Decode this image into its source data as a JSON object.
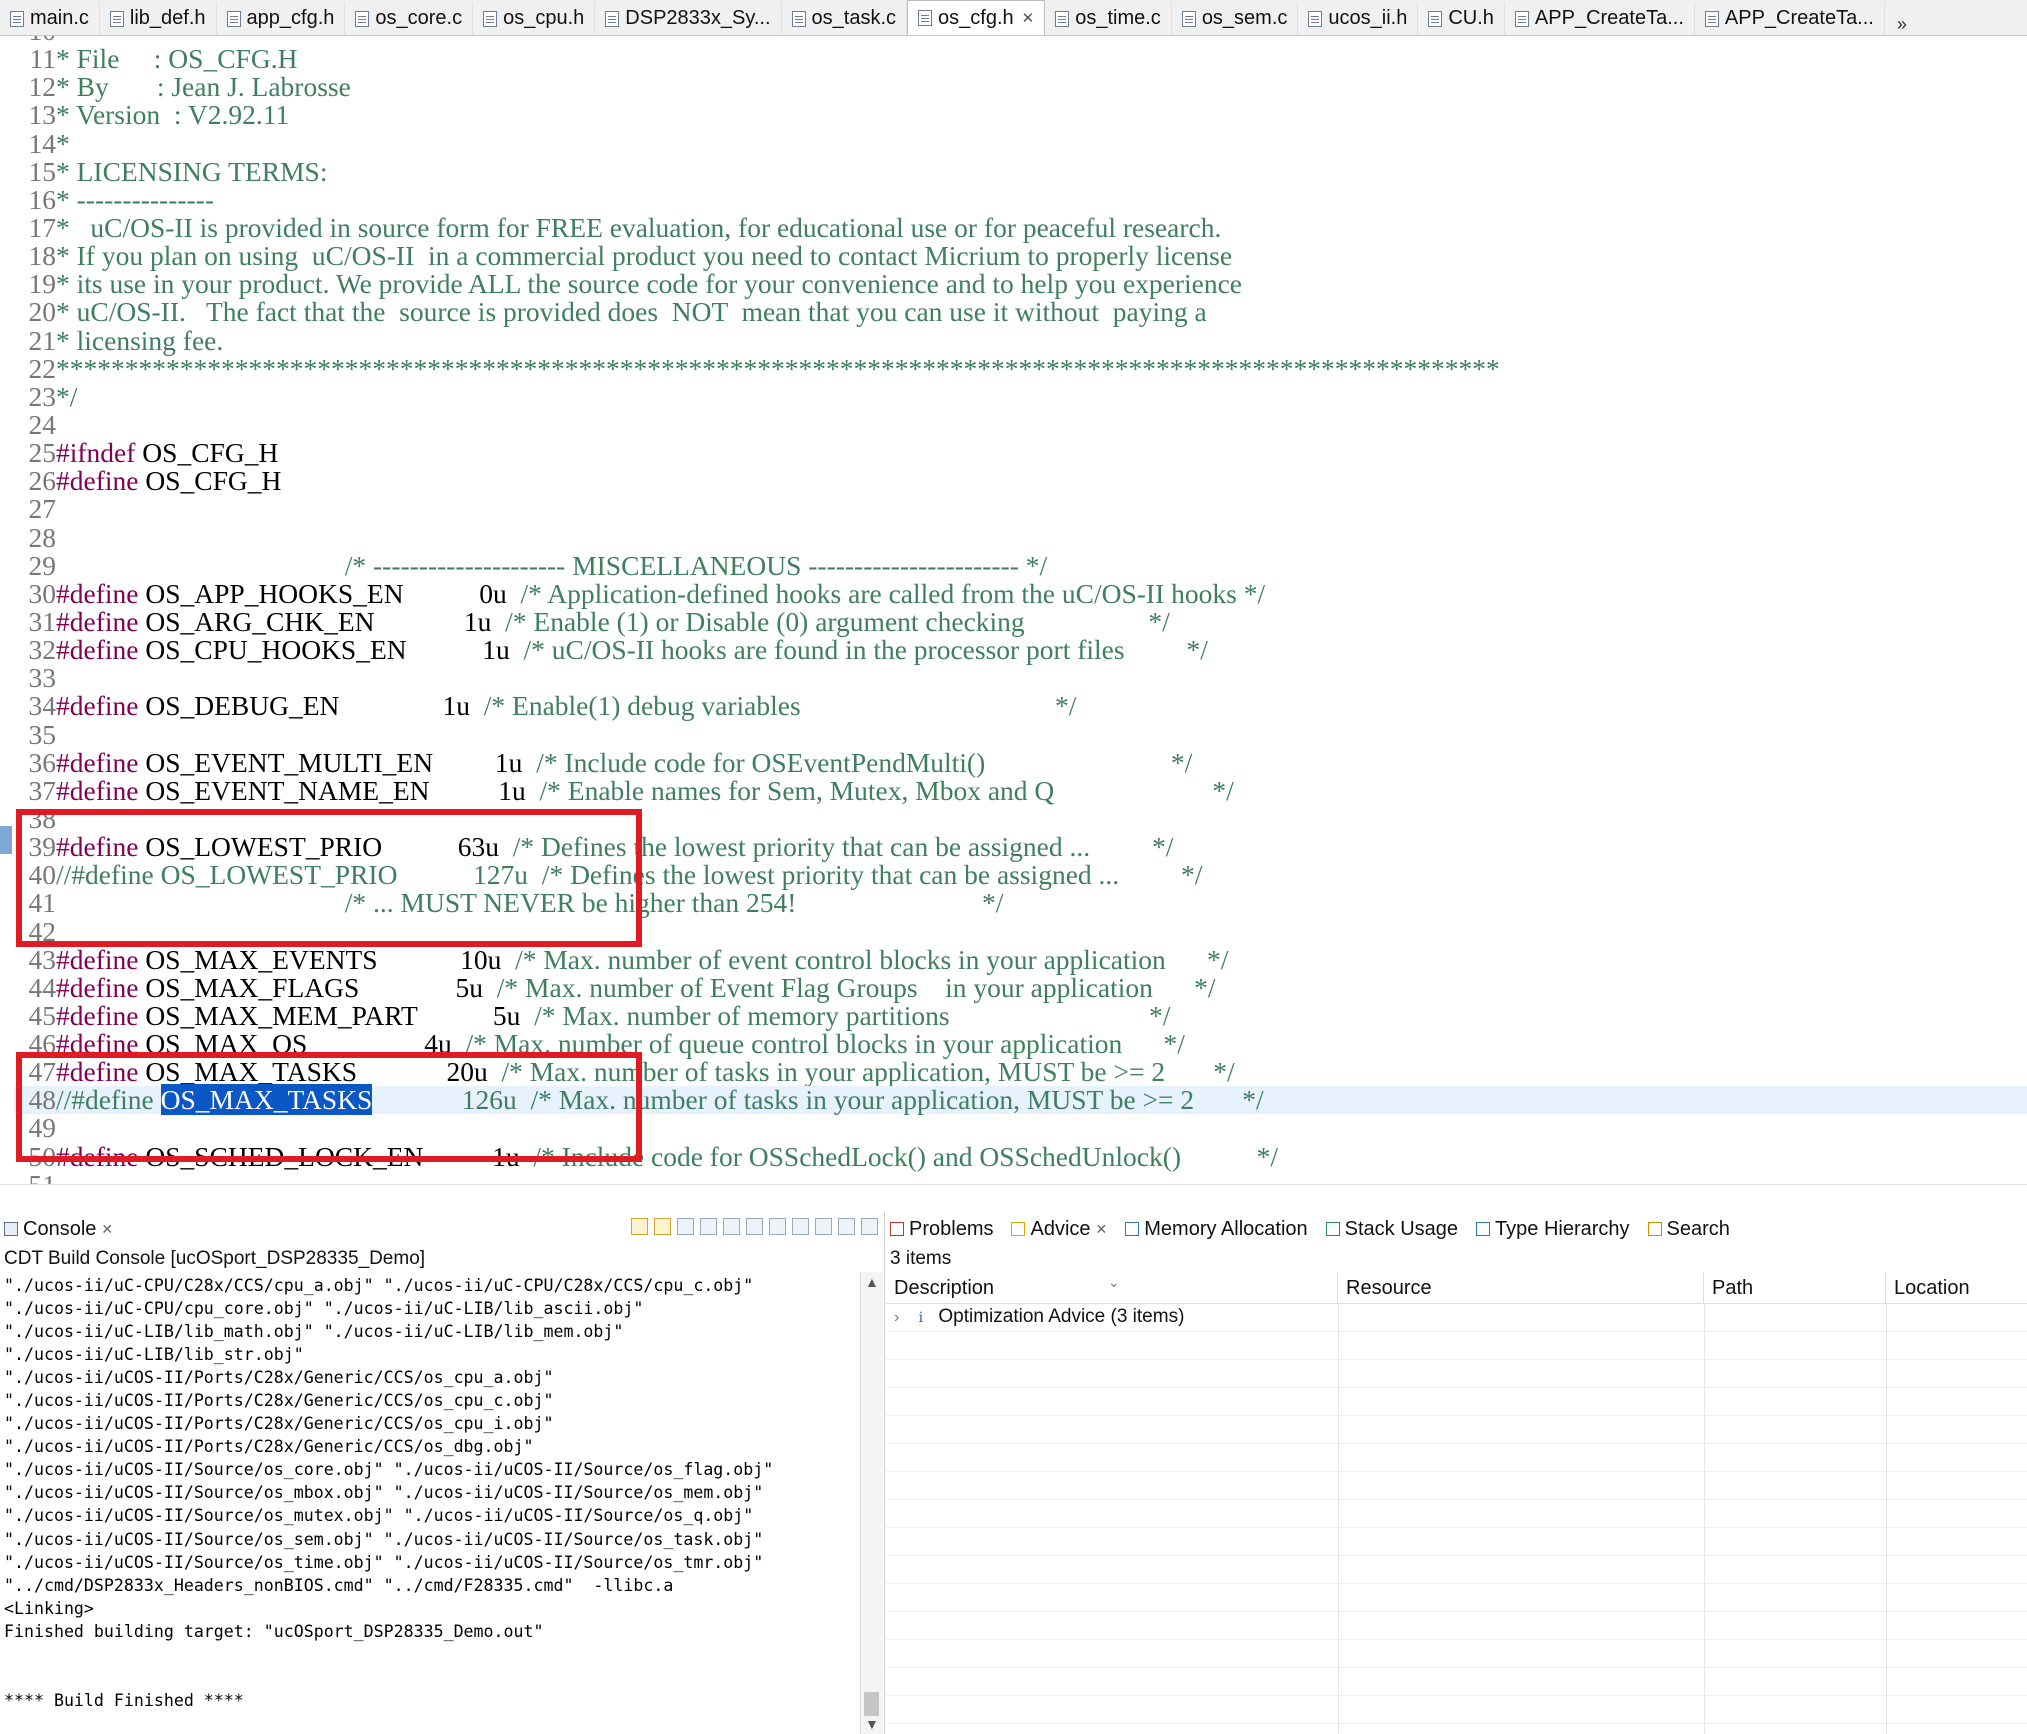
{
  "editor_tabs": [
    "main.c",
    "lib_def.h",
    "app_cfg.h",
    "os_core.c",
    "os_cpu.h",
    "DSP2833x_Sy...",
    "os_task.c",
    "os_cfg.h",
    "os_time.c",
    "os_sem.c",
    "ucos_ii.h",
    "CU.h",
    "APP_CreateTa...",
    "APP_CreateTa..."
  ],
  "active_tab": "os_cfg.h",
  "tab_overflow": "»",
  "code_lines": [
    {
      "n": "10",
      "t": "*"
    },
    {
      "n": "11",
      "t": "* File     : OS_CFG.H"
    },
    {
      "n": "12",
      "t": "* By       : Jean J. Labrosse"
    },
    {
      "n": "13",
      "t": "* Version  : V2.92.11"
    },
    {
      "n": "14",
      "t": "*"
    },
    {
      "n": "15",
      "t": "* LICENSING TERMS:"
    },
    {
      "n": "16",
      "t": "* ---------------"
    },
    {
      "n": "17",
      "t": "*   uC/OS-II is provided in source form for FREE evaluation, for educational use or for peaceful research."
    },
    {
      "n": "18",
      "t": "* If you plan on using  uC/OS-II  in a commercial product you need to contact Micrium to properly license"
    },
    {
      "n": "19",
      "t": "* its use in your product. We provide ALL the source code for your convenience and to help you experience"
    },
    {
      "n": "20",
      "t": "* uC/OS-II.   The fact that the  source is provided does  NOT  mean that you can use it without  paying a"
    },
    {
      "n": "21",
      "t": "* licensing fee."
    },
    {
      "n": "22",
      "t": "*********************************************************************************************************"
    },
    {
      "n": "23",
      "t": "*/"
    },
    {
      "n": "24",
      "t": ""
    },
    {
      "n": "25",
      "kw": "#ifndef",
      "t": " OS_CFG_H"
    },
    {
      "n": "26",
      "kw": "#define",
      "t": " OS_CFG_H"
    },
    {
      "n": "27",
      "t": ""
    },
    {
      "n": "28",
      "t": ""
    },
    {
      "n": "29",
      "c": "                                          /* --------------------- MISCELLANEOUS ----------------------- */"
    },
    {
      "n": "30",
      "kw": "#define",
      "t": " OS_APP_HOOKS_EN           0u",
      "c": "  /* Application-defined hooks are called from the uC/OS-II hooks */"
    },
    {
      "n": "31",
      "kw": "#define",
      "t": " OS_ARG_CHK_EN             1u",
      "c": "  /* Enable (1) or Disable (0) argument checking                  */"
    },
    {
      "n": "32",
      "kw": "#define",
      "t": " OS_CPU_HOOKS_EN           1u",
      "c": "  /* uC/OS-II hooks are found in the processor port files         */"
    },
    {
      "n": "33",
      "t": ""
    },
    {
      "n": "34",
      "kw": "#define",
      "t": " OS_DEBUG_EN               1u",
      "c": "  /* Enable(1) debug variables                                     */"
    },
    {
      "n": "35",
      "t": ""
    },
    {
      "n": "36",
      "kw": "#define",
      "t": " OS_EVENT_MULTI_EN         1u",
      "c": "  /* Include code for OSEventPendMulti()                           */"
    },
    {
      "n": "37",
      "kw": "#define",
      "t": " OS_EVENT_NAME_EN          1u",
      "c": "  /* Enable names for Sem, Mutex, Mbox and Q                       */"
    },
    {
      "n": "38",
      "t": ""
    },
    {
      "n": "39",
      "kw": "#define",
      "t": " OS_LOWEST_PRIO           63u",
      "c": "  /* Defines the lowest priority that can be assigned ...         */"
    },
    {
      "n": "40",
      "c": "//#define OS_LOWEST_PRIO           127u  /* Defines the lowest priority that can be assigned ...         */"
    },
    {
      "n": "41",
      "c": "                                          /* ... MUST NEVER be higher than 254!                           */"
    },
    {
      "n": "42",
      "t": ""
    },
    {
      "n": "43",
      "kw": "#define",
      "t": " OS_MAX_EVENTS            10u",
      "c": "  /* Max. number of event control blocks in your application      */"
    },
    {
      "n": "44",
      "kw": "#define",
      "t": " OS_MAX_FLAGS              5u",
      "c": "  /* Max. number of Event Flag Groups    in your application      */"
    },
    {
      "n": "45",
      "kw": "#define",
      "t": " OS_MAX_MEM_PART           5u",
      "c": "  /* Max. number of memory partitions                             */"
    },
    {
      "n": "46",
      "kw": "#define",
      "t": " OS_MAX_QS                 4u",
      "c": "  /* Max. number of queue control blocks in your application      */"
    },
    {
      "n": "47",
      "kw": "#define",
      "t": " OS_MAX_TASKS             20u",
      "c": "  /* Max. number of tasks in your application, MUST be >= 2       */"
    },
    {
      "n": "48",
      "c": "//#define ",
      "sel": "OS_MAX_TASKS",
      "c2": "             126u  /* Max. number of tasks in your application, MUST be >= 2       */"
    },
    {
      "n": "49",
      "t": ""
    },
    {
      "n": "50",
      "kw": "#define",
      "t": " OS_SCHED_LOCK_EN          1u",
      "c": "  /* Include code for OSSchedLock() and OSSchedUnlock()           */"
    },
    {
      "n": "51",
      "t": ""
    }
  ],
  "console": {
    "tab_label": "Console",
    "title": "CDT Build Console [ucOSport_DSP28335_Demo]",
    "lines": [
      "\"./ucos-ii/uC-CPU/C28x/CCS/cpu_a.obj\" \"./ucos-ii/uC-CPU/C28x/CCS/cpu_c.obj\"",
      "\"./ucos-ii/uC-CPU/cpu_core.obj\" \"./ucos-ii/uC-LIB/lib_ascii.obj\"",
      "\"./ucos-ii/uC-LIB/lib_math.obj\" \"./ucos-ii/uC-LIB/lib_mem.obj\"",
      "\"./ucos-ii/uC-LIB/lib_str.obj\"",
      "\"./ucos-ii/uCOS-II/Ports/C28x/Generic/CCS/os_cpu_a.obj\"",
      "\"./ucos-ii/uCOS-II/Ports/C28x/Generic/CCS/os_cpu_c.obj\"",
      "\"./ucos-ii/uCOS-II/Ports/C28x/Generic/CCS/os_cpu_i.obj\"",
      "\"./ucos-ii/uCOS-II/Ports/C28x/Generic/CCS/os_dbg.obj\"",
      "\"./ucos-ii/uCOS-II/Source/os_core.obj\" \"./ucos-ii/uCOS-II/Source/os_flag.obj\"",
      "\"./ucos-ii/uCOS-II/Source/os_mbox.obj\" \"./ucos-ii/uCOS-II/Source/os_mem.obj\"",
      "\"./ucos-ii/uCOS-II/Source/os_mutex.obj\" \"./ucos-ii/uCOS-II/Source/os_q.obj\"",
      "\"./ucos-ii/uCOS-II/Source/os_sem.obj\" \"./ucos-ii/uCOS-II/Source/os_task.obj\"",
      "\"./ucos-ii/uCOS-II/Source/os_time.obj\" \"./ucos-ii/uCOS-II/Source/os_tmr.obj\"",
      "\"../cmd/DSP2833x_Headers_nonBIOS.cmd\" \"../cmd/F28335.cmd\"  -llibc.a",
      "<Linking>",
      "Finished building target: \"ucOSport_DSP28335_Demo.out\"",
      "",
      "",
      "**** Build Finished ****"
    ]
  },
  "advice_panel": {
    "tabs": [
      "Problems",
      "Advice",
      "Memory Allocation",
      "Stack Usage",
      "Type Hierarchy",
      "Search"
    ],
    "active": "Advice",
    "count": "3 items",
    "columns": [
      "Description",
      "Resource",
      "Path",
      "Location"
    ],
    "item": "Optimization Advice (3 items)",
    "item_icon": "i"
  }
}
